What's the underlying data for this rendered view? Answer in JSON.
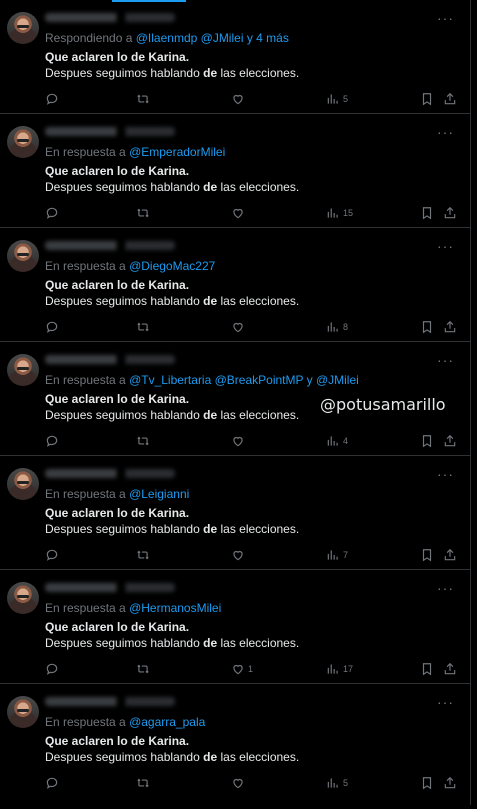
{
  "watermark": "@potusamarillo",
  "tweets": [
    {
      "reply_prefix": "Respondiendo a",
      "mentions": "@Ilaenmdp @JMilei y 4 más",
      "text_line1": "Que aclaren lo de Karina.",
      "text_line2_a": "Despues seguimos hablando",
      "text_line2_bold": "de",
      "text_line2_b": "las elecciones.",
      "likes": "",
      "views": "5"
    },
    {
      "reply_prefix": "En respuesta a",
      "mentions": "@EmperadorMilei",
      "text_line1": "Que aclaren lo de Karina.",
      "text_line2_a": "Despues seguimos hablando",
      "text_line2_bold": "de",
      "text_line2_b": "las elecciones.",
      "likes": "",
      "views": "15"
    },
    {
      "reply_prefix": "En respuesta a",
      "mentions": "@DiegoMac227",
      "text_line1": "Que aclaren lo de Karina.",
      "text_line2_a": "Despues seguimos hablando",
      "text_line2_bold": "de",
      "text_line2_b": "las elecciones.",
      "likes": "",
      "views": "8"
    },
    {
      "reply_prefix": "En respuesta a",
      "mentions": "@Tv_Libertaria @BreakPointMP y @JMilei",
      "text_line1": "Que aclaren lo de Karina.",
      "text_line2_a": "Despues seguimos hablando",
      "text_line2_bold": "de",
      "text_line2_b": "las elecciones.",
      "likes": "",
      "views": "4"
    },
    {
      "reply_prefix": "En respuesta a",
      "mentions": "@Leigianni",
      "text_line1": "Que aclaren lo de Karina.",
      "text_line2_a": "Despues seguimos hablando",
      "text_line2_bold": "de",
      "text_line2_b": "las elecciones.",
      "likes": "",
      "views": "7"
    },
    {
      "reply_prefix": "En respuesta a",
      "mentions": "@HermanosMilei",
      "text_line1": "Que aclaren lo de Karina.",
      "text_line2_a": "Despues seguimos hablando",
      "text_line2_bold": "de",
      "text_line2_b": "las elecciones.",
      "likes": "1",
      "views": "17"
    },
    {
      "reply_prefix": "En respuesta a",
      "mentions": "@agarra_pala",
      "text_line1": "Que aclaren lo de Karina.",
      "text_line2_a": "Despues seguimos hablando",
      "text_line2_bold": "de",
      "text_line2_b": "las elecciones.",
      "likes": "",
      "views": "5"
    }
  ]
}
